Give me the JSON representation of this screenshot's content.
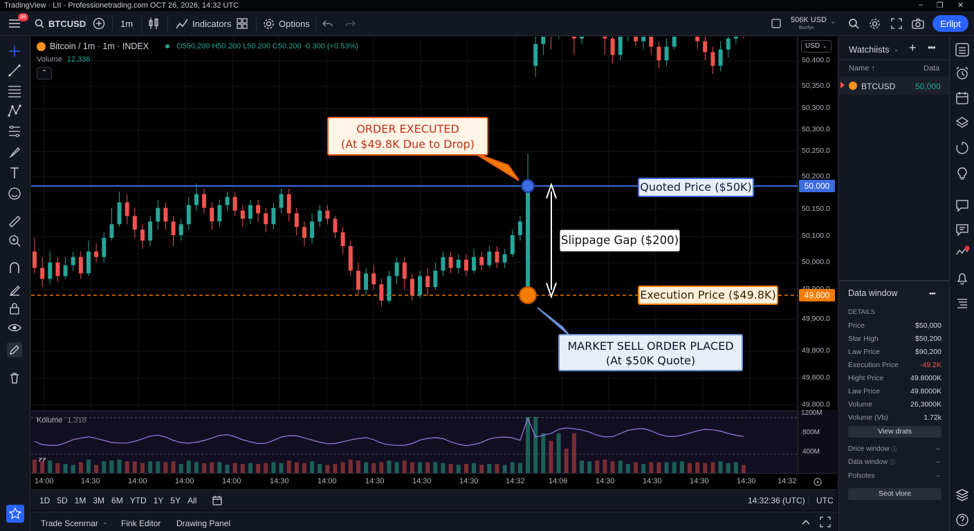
{
  "titlebar": {
    "text": "TradingView · LII · Professionetrading.com   OCT 26, 2026, 14:32 UTC",
    "win_min": "–",
    "win_max": "❐",
    "win_close": "✕"
  },
  "toolbar": {
    "menu_badge": "86",
    "symbol": "BTCUSD",
    "interval": "1m",
    "indicators": "Indicators",
    "options": "Options",
    "account_value": "506K USD",
    "account_sub": "Bunfyn",
    "fullscreen_btn": "Erllpt"
  },
  "legend": {
    "symbol_title": "Bitcoin / 1m · 1m · INDEX",
    "ohlc": "O550,200  H50.200  L50.200  C50.200  -0.300  (+0.53%)",
    "volume_label": "Volume",
    "volume_value": "12.336"
  },
  "price_scale": {
    "currency": "USD",
    "ticks": [
      "50,400.0",
      "50,350.0",
      "50,300.0",
      "50,300.0",
      "50,250.0",
      "50,200.0",
      "50,150.0",
      "50,100.0",
      "50,000.0",
      "49,900.0",
      "49,900.0",
      "49,800.0",
      "49,800.0",
      "49,800.0"
    ],
    "quoted_tag": "50.000",
    "exec_tag": "49,800"
  },
  "annotations": {
    "order_executed_line1": "ORDER EXECUTED",
    "order_executed_line2": "(At $49.8K Due to Drop)",
    "quoted_price": "Quoted Price ($50K)",
    "slippage_gap": "Slippage Gap ($200)",
    "execution_price": "Execution Price ($49.8K)",
    "market_sell_line1": "MARKET SELL ORDER PLACED",
    "market_sell_line2": "(At $50K Quote)"
  },
  "volume_panel": {
    "label": "Kolume",
    "value": "1.318",
    "ticks": [
      "1200M",
      "800M",
      "400M"
    ]
  },
  "time_axis": {
    "ticks": [
      "14:00",
      "14:30",
      "14:00",
      "14:00",
      "14:00",
      "14:30",
      "14:00",
      "14:30",
      "14:30",
      "14:30",
      "14:32",
      "14:06",
      "14:30",
      "14:30",
      "14:30",
      "14:30",
      "14:32"
    ]
  },
  "range_bar": {
    "ranges": [
      "1D",
      "5D",
      "1M",
      "3M",
      "6M",
      "YTD",
      "1Y",
      "5Y",
      "All"
    ],
    "clock": "14:32:36 (UTC)",
    "tz": "UTC"
  },
  "bottom_tabs": [
    "Trade Scenrnar",
    "Fink Editor",
    "Drawing Panel"
  ],
  "watchlist": {
    "title": "Watchiists",
    "col_name": "Name ↑",
    "col_data": "Data",
    "rows": [
      {
        "symbol": "BTCUSD",
        "value": "50,000"
      }
    ]
  },
  "data_window": {
    "title": "Data window",
    "section": "DETAILS",
    "rows": [
      {
        "k": "Price",
        "v": "$50,000"
      },
      {
        "k": "Star High",
        "v": "$50,200"
      },
      {
        "k": "Law Price",
        "v": "$90,200"
      },
      {
        "k": "Execution Price",
        "v": "-49.2K"
      },
      {
        "k": "Hight Price",
        "v": "49.8000K"
      },
      {
        "k": "Law Price",
        "v": "49.8000K"
      },
      {
        "k": "Volume",
        "v": "26,3000K"
      },
      {
        "k": "Volume (Vb)",
        "v": "1.72k"
      }
    ],
    "view_btn": "View drats",
    "links": [
      "Drice window",
      "Data window",
      "Polsotes"
    ],
    "seot_btn": "Seot vlore"
  },
  "colors": {
    "up": "#26a69a",
    "down": "#ef5350",
    "quoted_line": "#3d6be0",
    "exec_line": "#f57c00",
    "accent": "#2962ff"
  },
  "chart_data": {
    "type": "candlestick",
    "y_unit": "USD",
    "ylim": [
      49750,
      50420
    ],
    "quoted_price": 50000,
    "execution_price": 49800,
    "candles": [
      [
        49880,
        49850,
        49905,
        49840
      ],
      [
        49850,
        49830,
        49870,
        49815
      ],
      [
        49830,
        49860,
        49880,
        49820
      ],
      [
        49860,
        49835,
        49870,
        49825
      ],
      [
        49835,
        49855,
        49870,
        49830
      ],
      [
        49855,
        49870,
        49880,
        49845
      ],
      [
        49870,
        49840,
        49880,
        49830
      ],
      [
        49840,
        49880,
        49900,
        49835
      ],
      [
        49880,
        49870,
        49895,
        49860
      ],
      [
        49870,
        49905,
        49915,
        49860
      ],
      [
        49905,
        49930,
        49960,
        49900
      ],
      [
        49930,
        49970,
        49990,
        49925
      ],
      [
        49970,
        49945,
        49985,
        49930
      ],
      [
        49945,
        49920,
        49960,
        49905
      ],
      [
        49920,
        49900,
        49930,
        49885
      ],
      [
        49900,
        49935,
        49945,
        49890
      ],
      [
        49935,
        49960,
        49975,
        49920
      ],
      [
        49960,
        49935,
        49970,
        49920
      ],
      [
        49935,
        49910,
        49945,
        49890
      ],
      [
        49910,
        49930,
        49940,
        49900
      ],
      [
        49930,
        49965,
        49980,
        49920
      ],
      [
        49965,
        49985,
        50005,
        49955
      ],
      [
        49985,
        49960,
        49995,
        49950
      ],
      [
        49960,
        49935,
        49970,
        49920
      ],
      [
        49935,
        49965,
        49975,
        49925
      ],
      [
        49965,
        49980,
        49990,
        49955
      ],
      [
        49980,
        49955,
        49990,
        49945
      ],
      [
        49955,
        49940,
        49965,
        49925
      ],
      [
        49940,
        49965,
        49975,
        49930
      ],
      [
        49965,
        49950,
        49975,
        49935
      ],
      [
        49950,
        49930,
        49960,
        49915
      ],
      [
        49930,
        49960,
        49970,
        49920
      ],
      [
        49960,
        49985,
        49995,
        49950
      ],
      [
        49985,
        49950,
        49995,
        49935
      ],
      [
        49950,
        49925,
        49960,
        49910
      ],
      [
        49925,
        49905,
        49935,
        49890
      ],
      [
        49905,
        49935,
        49950,
        49895
      ],
      [
        49935,
        49955,
        49965,
        49925
      ],
      [
        49955,
        49940,
        49965,
        49930
      ],
      [
        49940,
        49915,
        49945,
        49905
      ],
      [
        49915,
        49890,
        49925,
        49875
      ],
      [
        49890,
        49845,
        49900,
        49835
      ],
      [
        49845,
        49810,
        49860,
        49800
      ],
      [
        49810,
        49840,
        49850,
        49800
      ],
      [
        49840,
        49820,
        49855,
        49810
      ],
      [
        49820,
        49790,
        49830,
        49780
      ],
      [
        49790,
        49835,
        49845,
        49785
      ],
      [
        49835,
        49860,
        49870,
        49820
      ],
      [
        49860,
        49830,
        49870,
        49810
      ],
      [
        49830,
        49800,
        49840,
        49790
      ],
      [
        49800,
        49835,
        49845,
        49795
      ],
      [
        49835,
        49815,
        49850,
        49800
      ],
      [
        49815,
        49845,
        49860,
        49810
      ],
      [
        49845,
        49870,
        49880,
        49835
      ],
      [
        49870,
        49850,
        49880,
        49840
      ],
      [
        49850,
        49865,
        49875,
        49840
      ],
      [
        49865,
        49845,
        49875,
        49835
      ],
      [
        49845,
        49870,
        49885,
        49840
      ],
      [
        49870,
        49855,
        49880,
        49845
      ],
      [
        49855,
        49880,
        49890,
        49850
      ],
      [
        49880,
        49860,
        49890,
        49850
      ],
      [
        49860,
        49875,
        49885,
        49850
      ],
      [
        49875,
        49910,
        49920,
        49870
      ],
      [
        49910,
        49935,
        49945,
        49900
      ],
      [
        49800,
        50000,
        50060,
        49795
      ],
      [
        50220,
        50260,
        50380,
        50200
      ],
      [
        50260,
        50310,
        50330,
        50240
      ],
      [
        50310,
        50280,
        50320,
        50250
      ],
      [
        50280,
        50340,
        50360,
        50270
      ],
      [
        50340,
        50320,
        50350,
        50300
      ],
      [
        50320,
        50270,
        50330,
        50240
      ],
      [
        50270,
        50300,
        50320,
        50260
      ],
      [
        50300,
        50330,
        50345,
        50290
      ],
      [
        50330,
        50300,
        50340,
        50280
      ],
      [
        50300,
        50270,
        50305,
        50240
      ],
      [
        50270,
        50240,
        50280,
        50225
      ],
      [
        50240,
        50275,
        50290,
        50230
      ],
      [
        50275,
        50295,
        50305,
        50265
      ],
      [
        50295,
        50265,
        50305,
        50255
      ],
      [
        50265,
        50280,
        50290,
        50250
      ],
      [
        50280,
        50255,
        50290,
        50240
      ],
      [
        50255,
        50230,
        50265,
        50215
      ],
      [
        50230,
        50255,
        50270,
        50220
      ],
      [
        50255,
        50285,
        50300,
        50250
      ],
      [
        50285,
        50310,
        50330,
        50275
      ],
      [
        50310,
        50290,
        50320,
        50275
      ],
      [
        50290,
        50265,
        50300,
        50250
      ],
      [
        50265,
        50245,
        50275,
        50230
      ],
      [
        50245,
        50220,
        50255,
        50205
      ],
      [
        50220,
        50250,
        50265,
        50210
      ],
      [
        50250,
        50270,
        50280,
        50235
      ],
      [
        50270,
        50300,
        50310,
        50260
      ],
      [
        50300,
        50285,
        50305,
        50270
      ]
    ]
  }
}
